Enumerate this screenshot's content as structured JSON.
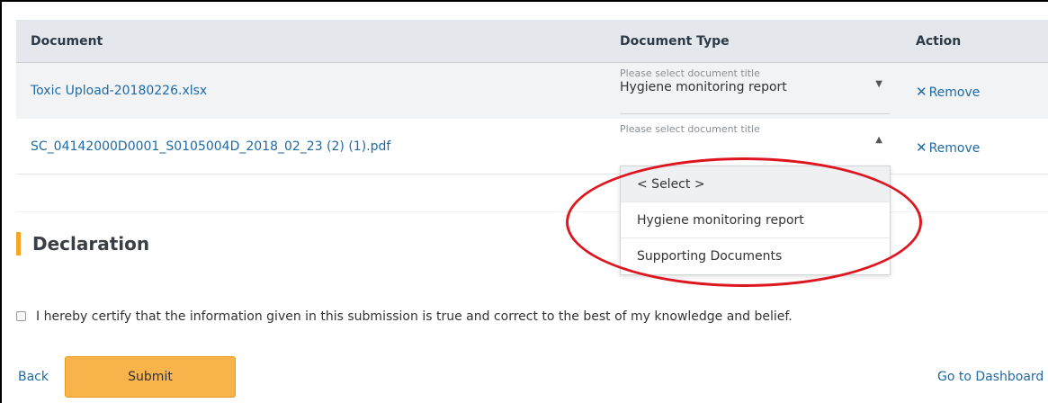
{
  "table": {
    "headers": {
      "document": "Document",
      "type": "Document Type",
      "action": "Action"
    },
    "rows": [
      {
        "document": "Toxic Upload-20180226.xlsx",
        "placeholder": "Please select document title",
        "selected": "Hygiene monitoring report",
        "arrow": "▼",
        "remove_icon": "✕",
        "remove": "Remove"
      },
      {
        "document": "SC_04142000D0001_S0105004D_2018_02_23 (2) (1).pdf",
        "placeholder": "Please select document title",
        "selected": "",
        "arrow": "▲",
        "remove_icon": "✕",
        "remove": "Remove"
      }
    ]
  },
  "dropdown": {
    "options": [
      "< Select >",
      "Hygiene monitoring report",
      "Supporting Documents"
    ],
    "highlighted_index": 0
  },
  "annotation": {
    "color": "#dd1620"
  },
  "declaration": {
    "title": "Declaration",
    "certify_text": "I hereby certify that the information given in this submission is true and correct to the best of my knowledge and belief.",
    "checked": false
  },
  "footer": {
    "back": "Back",
    "submit": "Submit",
    "dashboard": "Go to Dashboard"
  },
  "colors": {
    "accent": "#f6a623",
    "link": "#1f6aa5",
    "submit_bg": "#f8b44a",
    "header_bg": "#e4e7eb"
  }
}
